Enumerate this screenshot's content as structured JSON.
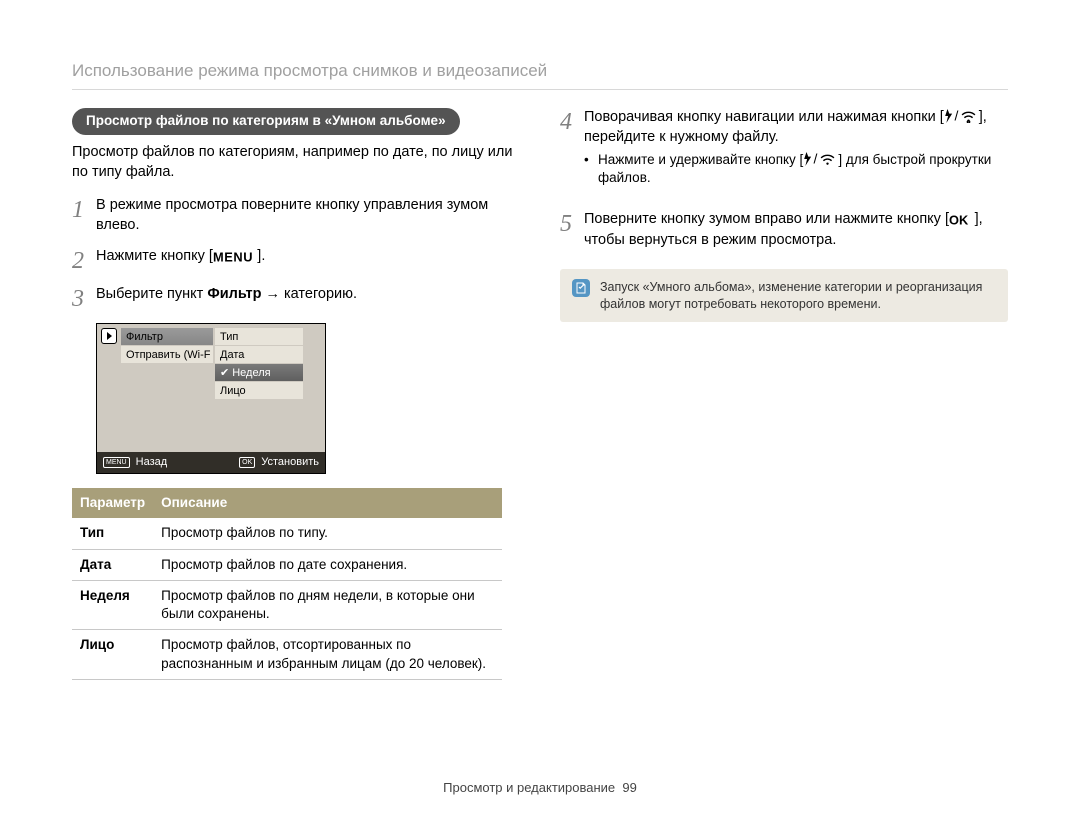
{
  "header": {
    "title": "Использование режима просмотра снимков и видеозаписей"
  },
  "left": {
    "pill": "Просмотр файлов по категориям в «Умном альбоме»",
    "intro": "Просмотр файлов по категориям, например по дате, по лицу или по типу файла.",
    "step1": "В режиме просмотра поверните кнопку управления зумом влево.",
    "step2_a": "Нажмите кнопку [",
    "step2_b": "].",
    "step3_a": "Выберите пункт ",
    "step3_bold": "Фильтр",
    "step3_b": " → категорию.",
    "cam": {
      "col1": [
        "Фильтр",
        "Отправить (Wi-F"
      ],
      "col2": [
        "Тип",
        "Дата",
        "Неделя",
        "Лицо"
      ],
      "back": "Назад",
      "set": "Установить",
      "menu_btn": "MENU",
      "ok_btn": "OK"
    },
    "table": {
      "h1": "Параметр",
      "h2": "Описание",
      "rows": [
        {
          "p": "Тип",
          "d": "Просмотр файлов по типу."
        },
        {
          "p": "Дата",
          "d": "Просмотр файлов по дате сохранения."
        },
        {
          "p": "Неделя",
          "d": "Просмотр файлов по дням недели, в которые они были сохранены."
        },
        {
          "p": "Лицо",
          "d": "Просмотр файлов, отсортированных по распознанным и избранным лицам (до 20 человек)."
        }
      ]
    }
  },
  "right": {
    "step4_a": "Поворачивая кнопку навигации или нажимая кнопки [",
    "step4_b": "], перейдите к нужному файлу.",
    "step4_bullet_a": "Нажмите и удерживайте кнопку [",
    "step4_bullet_b": "] для быстрой прокрутки файлов.",
    "step5_a": "Поверните кнопку зумом вправо или нажмите кнопку [",
    "step5_b": "], чтобы вернуться в режим просмотра.",
    "note": "Запуск «Умного альбома», изменение категории и реорганизация файлов могут потребовать некоторого времени."
  },
  "glyphs": {
    "menu": "MENU",
    "ok": "OK"
  },
  "footer": {
    "section": "Просмотр и редактирование",
    "page": "99"
  }
}
